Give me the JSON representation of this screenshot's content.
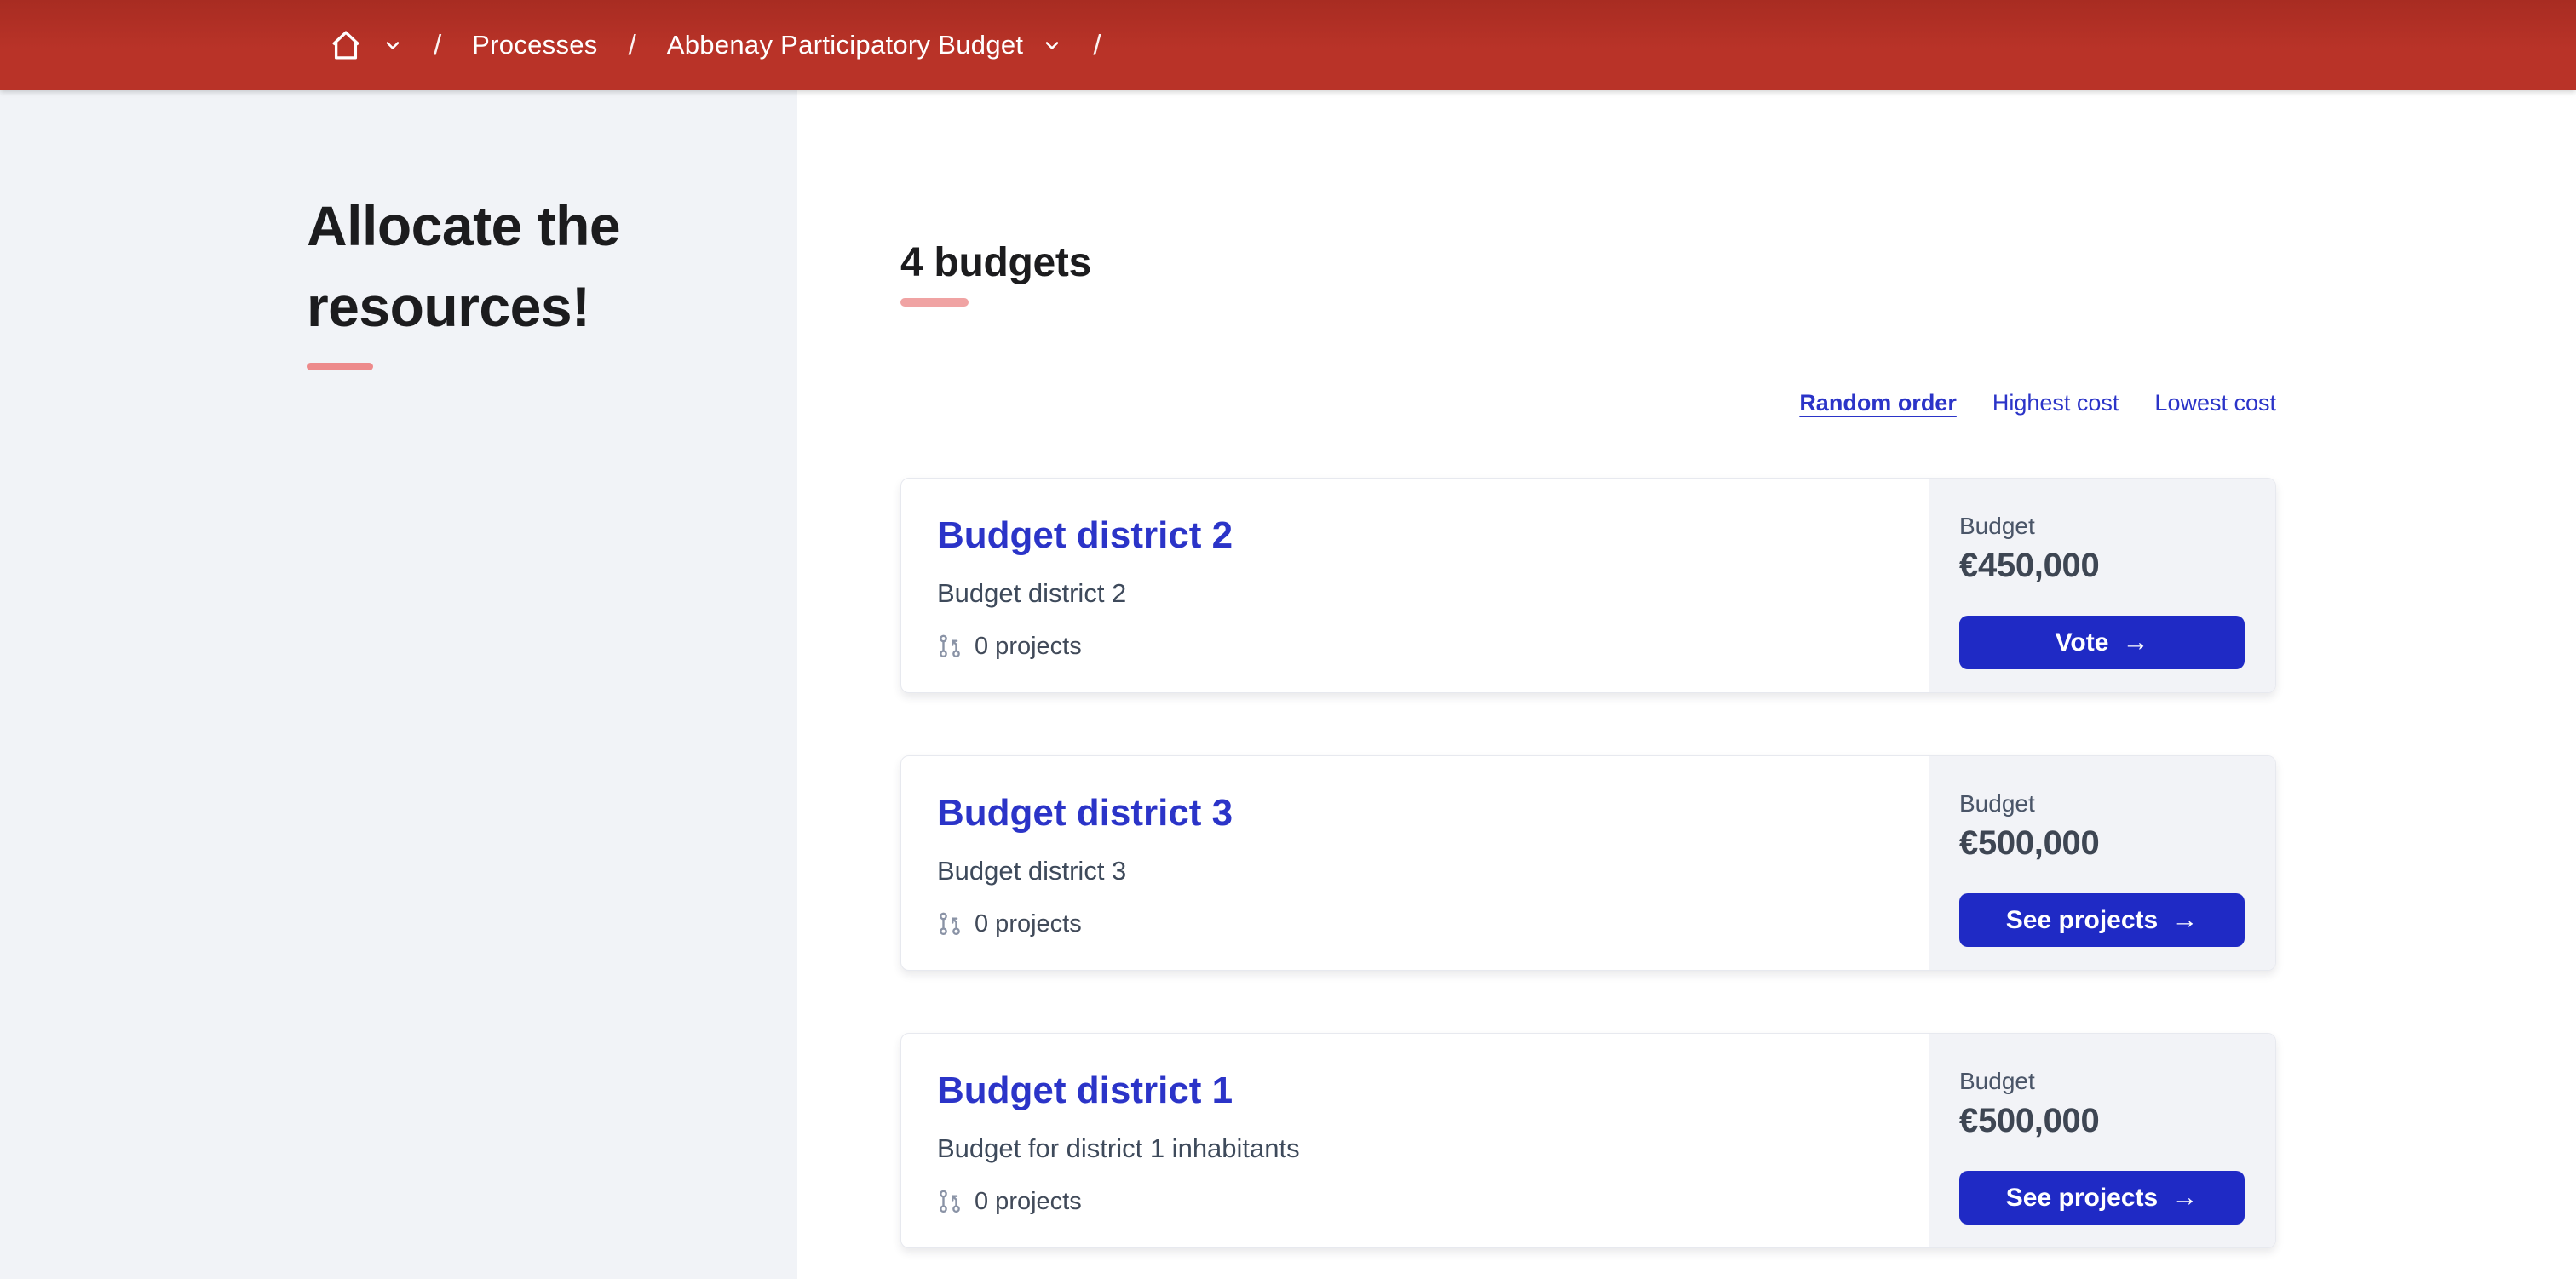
{
  "header": {
    "breadcrumb": {
      "separator": "/",
      "items": [
        {
          "label": "Processes"
        },
        {
          "label": "Abbenay Participatory Budget"
        }
      ]
    }
  },
  "sidebar": {
    "title": "Allocate the resources!"
  },
  "main": {
    "heading": "4 budgets",
    "sort": {
      "options": [
        {
          "label": "Random order",
          "active": true
        },
        {
          "label": "Highest cost",
          "active": false
        },
        {
          "label": "Lowest cost",
          "active": false
        }
      ]
    },
    "cards": [
      {
        "title": "Budget district 2",
        "description": "Budget district 2",
        "projects": "0 projects",
        "budget_label": "Budget",
        "amount": "€450,000",
        "button_label": "Vote"
      },
      {
        "title": "Budget district 3",
        "description": "Budget district 3",
        "projects": "0 projects",
        "budget_label": "Budget",
        "amount": "€500,000",
        "button_label": "See projects"
      },
      {
        "title": "Budget district 1",
        "description": "Budget for district 1 inhabitants",
        "projects": "0 projects",
        "budget_label": "Budget",
        "amount": "€500,000",
        "button_label": "See projects"
      }
    ]
  },
  "icons": {
    "arrow_right": "→"
  },
  "colors": {
    "header_red": "#b93328",
    "primary_blue": "#2b34c8",
    "button_blue": "#1f2ac5",
    "sidebar_bg": "#f1f3f7",
    "aside_panel_bg": "#f2f3f7",
    "salmon_accent_sidebar": "#ed8a8b",
    "salmon_accent_main": "#f0a3a3"
  }
}
